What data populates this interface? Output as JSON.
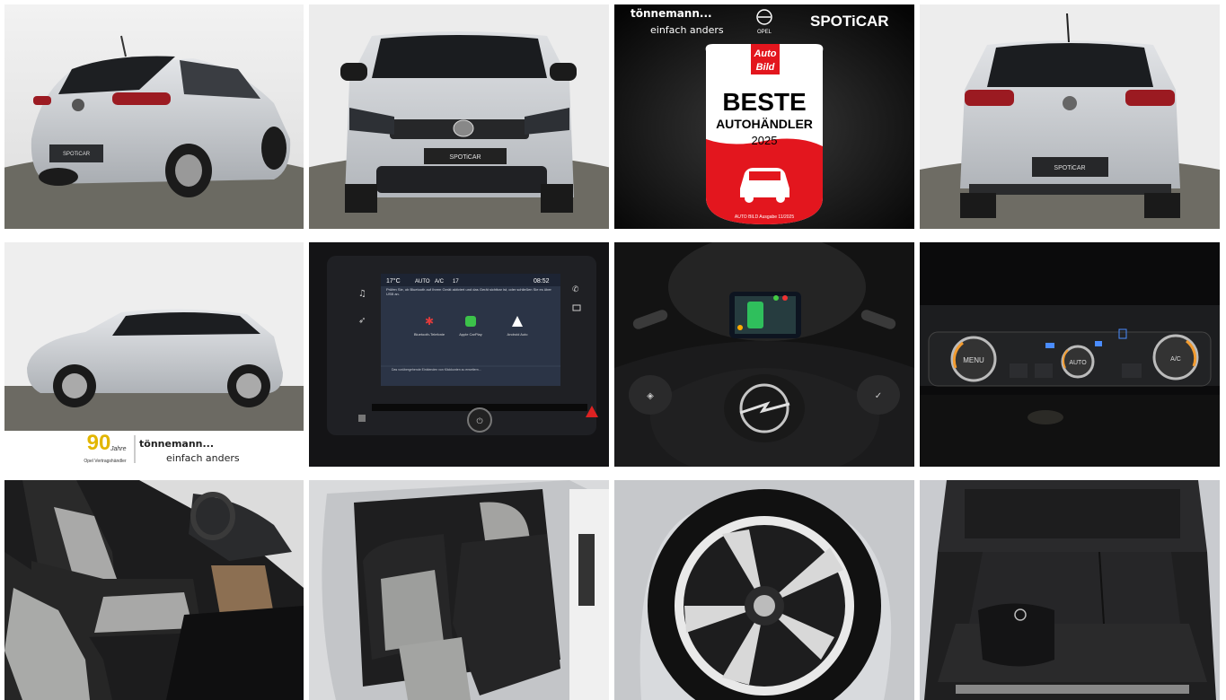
{
  "gallery": {
    "photos": [
      {
        "subject": "rear-three-quarter"
      },
      {
        "subject": "front"
      },
      {
        "subject": "award-badge"
      },
      {
        "subject": "rear"
      },
      {
        "subject": "side-profile"
      },
      {
        "subject": "infotainment-screen"
      },
      {
        "subject": "steering-wheel"
      },
      {
        "subject": "climate-controls"
      },
      {
        "subject": "front-seats"
      },
      {
        "subject": "rear-seats"
      },
      {
        "subject": "wheel"
      },
      {
        "subject": "trunk"
      }
    ]
  },
  "branding": {
    "dealer_name": "tönnemann...",
    "dealer_slogan": "einfach anders",
    "opel_wordmark": "OPEL",
    "spoticar_logo": "SPOTiCAR",
    "plate_text": "SPOTiCAR",
    "anniversary_number": "90",
    "anniversary_word": "Jahre",
    "anniversary_caption": "Opel Vertragshändler"
  },
  "award": {
    "auto_word": "Auto",
    "bild_word": "Bild",
    "title": "BESTE",
    "subtitle": "AUTOHÄNDLER",
    "year": "2025",
    "footnote": "AUTO BILD Ausgabe 11/2025"
  },
  "infotainment": {
    "temperature": "17°C",
    "mode": "AUTO",
    "ac": "A/C",
    "fan": "17",
    "time": "08:52",
    "message": "Prüfen Sie, ob Bluetooth auf Ihrem Gerät aktiviert und das Gerät sichtbar ist, oder schließen Sie es über USB an.",
    "options": [
      "Bluetooth-Telefonie",
      "Apple CarPlay",
      "Android Auto"
    ],
    "footer": "Das vorübergehende Einblenden von Klickkonten zu erweitern..."
  },
  "climate": {
    "left_knob": "MENU",
    "center_knob": "AUTO",
    "right_knob": "A/C"
  },
  "colors": {
    "spoticar_accent": "#18c6c6",
    "award_red": "#e3161e",
    "car_silver": "#c9ccd0"
  }
}
